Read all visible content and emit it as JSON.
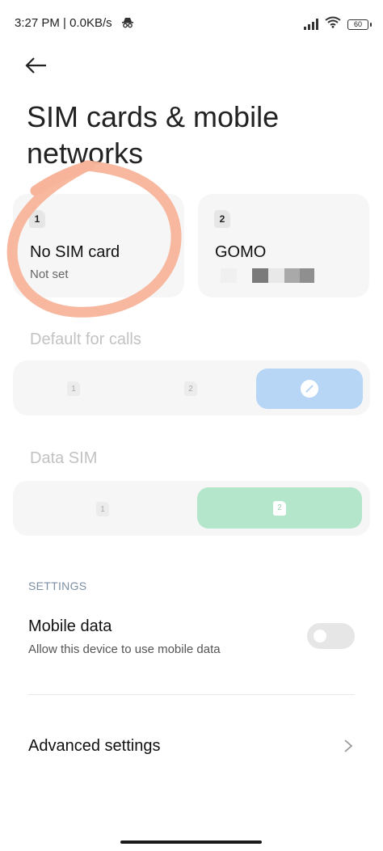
{
  "status_bar": {
    "time_speed": "3:27 PM | 0.0KB/s",
    "battery": "60"
  },
  "page": {
    "title": "SIM cards & mobile networks"
  },
  "sim_cards": [
    {
      "slot": "1",
      "name": "No SIM card",
      "status": "Not set"
    },
    {
      "slot": "2",
      "name": "GOMO"
    }
  ],
  "default_calls": {
    "label": "Default for calls",
    "options": [
      "1",
      "2"
    ]
  },
  "data_sim": {
    "label": "Data SIM",
    "options": [
      "1",
      "2"
    ]
  },
  "settings": {
    "header": "SETTINGS",
    "mobile_data": {
      "title": "Mobile data",
      "subtitle": "Allow this device to use mobile data",
      "enabled": false
    },
    "advanced": {
      "title": "Advanced settings"
    }
  },
  "colors": {
    "calls_selected": "#b7d6f6",
    "data_selected": "#b4e6cc",
    "annotation": "#f7b49a"
  }
}
